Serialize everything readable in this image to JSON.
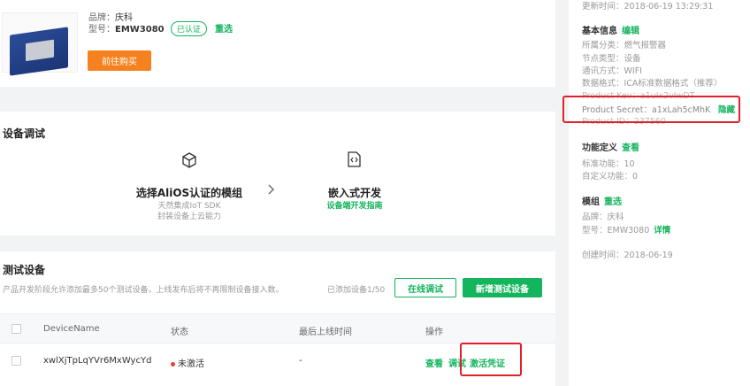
{
  "product": {
    "brand_label": "品牌：",
    "brand_value": "庆科",
    "model_label": "型号：",
    "model_value": "EMW3080",
    "certified_badge": "已认证",
    "reselect_link": "重选",
    "buy_button": "前往购买"
  },
  "debug": {
    "title": "设备调试",
    "option1_title": "选择AliOS认证的模组",
    "option1_sub1": "天然集成IoT SDK",
    "option1_sub2": "封装设备上云能力",
    "option2_title": "嵌入式开发",
    "option2_link": "设备端开发指南"
  },
  "test": {
    "title": "测试设备",
    "description": "产品开发阶段允许添加最多50个测试设备，上线发布后将不再限制设备接入数。",
    "added_count": "已添加设备1/50",
    "online_debug_button": "在线调试",
    "add_device_button": "新增测试设备",
    "columns": [
      "DeviceName",
      "状态",
      "最后上线时间",
      "操作"
    ],
    "rows": [
      {
        "device_name": "xwlXjTpLqYVr6MxWycYd",
        "status": "未激活",
        "last_online": "-",
        "actions": [
          "查看",
          "调试",
          "激活凭证"
        ]
      }
    ]
  },
  "sidebar": {
    "updated": "更新时间：2018-06-19 13:29:31",
    "basic_info_title": "基本信息",
    "edit_link": "编辑",
    "category": "所属分类：燃气报警器",
    "node_type": "节点类型：设备",
    "comm_method": "通讯方式：WIFI",
    "data_format": "数据格式：ICA标准数据格式（推荐）",
    "product_key": "Product Key：a1uJx2vJwDT",
    "product_secret": "Product Secret：a1xLah5cMhK",
    "hide_link": "隐藏",
    "product_id": "Product ID：237560",
    "func_def_title": "功能定义",
    "view_link": "查看",
    "std_func": "标准功能：10",
    "custom_func": "自定义功能：0",
    "module_title": "模组",
    "module_reselect": "重选",
    "module_brand": "品牌：庆科",
    "module_model": "型号：EMW3080",
    "details_link": "详情",
    "created": "创建时间：2018-06-19"
  },
  "colors": {
    "accent_green": "#14b55e",
    "buy_orange": "#f5821f",
    "highlight_red": "#e0202a",
    "status_red": "#e8422f"
  }
}
